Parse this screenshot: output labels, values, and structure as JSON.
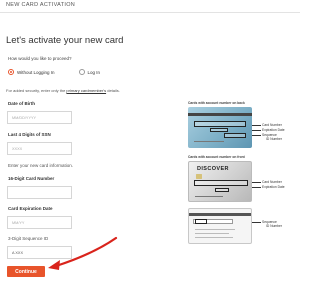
{
  "header": {
    "title": "NEW CARD ACTIVATION"
  },
  "main": {
    "title": "Let's activate your new card",
    "proceed_question": "How would you like to proceed?",
    "options": [
      {
        "label": "Without Logging In",
        "selected": true
      },
      {
        "label": "Log In",
        "selected": false
      }
    ],
    "security_note_prefix": "For added security, enter only the",
    "security_note_link": "primary cardmember's",
    "security_note_suffix": "details."
  },
  "fields": {
    "dob": {
      "label": "Date of Birth",
      "placeholder": "MM/DD/YYYY"
    },
    "ssn": {
      "label": "Last 4 Digits of SSN",
      "placeholder": "XXXX"
    },
    "card_info_intro": "Enter your new card information.",
    "card_number": {
      "label": "16-Digit Card Number",
      "placeholder": ""
    },
    "expiration": {
      "label": "Card Expiration Date",
      "placeholder": "MM/YY"
    },
    "sequence": {
      "label": "3-Digit Sequence ID",
      "value": "A XXX"
    }
  },
  "continue_label": "Continue",
  "cards": {
    "top": {
      "caption": "Cards with account number on back",
      "callouts": [
        "Card Number",
        "Expiration Date",
        "Sequence",
        "ID Number"
      ]
    },
    "middle": {
      "caption": "Cards with account number on front",
      "brand": "DISCOVER",
      "callouts": [
        "Card Number",
        "Expiration Date"
      ]
    },
    "bottom": {
      "callouts": [
        "Sequence",
        "ID Number"
      ]
    }
  },
  "colors": {
    "accent": "#e8542b",
    "arrow": "#d9241c"
  }
}
